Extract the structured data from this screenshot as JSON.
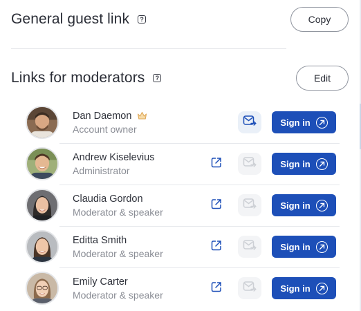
{
  "general": {
    "title": "General guest link",
    "help_glyph": "?",
    "copy_label": "Copy"
  },
  "moderators": {
    "title": "Links for moderators",
    "help_glyph": "?",
    "edit_label": "Edit",
    "items": [
      {
        "name": "Dan Daemon",
        "role": "Account owner",
        "owner": true,
        "signin_label": "Sign in",
        "mail_state": "active"
      },
      {
        "name": "Andrew Kiselevius",
        "role": "Administrator",
        "owner": false,
        "signin_label": "Sign in",
        "mail_state": "disabled"
      },
      {
        "name": "Claudia Gordon",
        "role": "Moderator & speaker",
        "owner": false,
        "signin_label": "Sign in",
        "mail_state": "disabled"
      },
      {
        "name": "Editta Smith",
        "role": "Moderator & speaker",
        "owner": false,
        "signin_label": "Sign in",
        "mail_state": "disabled"
      },
      {
        "name": "Emily Carter",
        "role": "Moderator & speaker",
        "owner": false,
        "signin_label": "Sign in",
        "mail_state": "disabled"
      }
    ]
  },
  "colors": {
    "primary": "#1d4fb8",
    "text": "#2c2f3a",
    "muted": "#8a8d95",
    "crown": "#e9b96b"
  },
  "icons": {
    "help": "help-icon",
    "crown": "crown-icon",
    "edit": "edit-link-icon",
    "mail": "mail-forward-icon",
    "signin": "arrow-up-right-circle-icon"
  }
}
